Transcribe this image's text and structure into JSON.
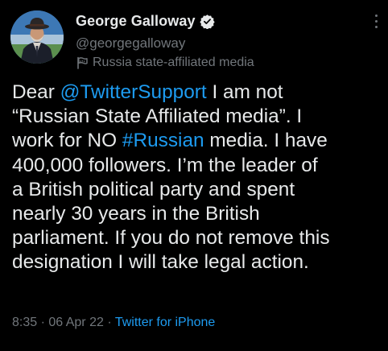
{
  "user": {
    "display_name": "George Galloway",
    "handle": "@georgegalloway",
    "label": "Russia state-affiliated media"
  },
  "tweet": {
    "lines": [
      {
        "pre": "Dear ",
        "link": "@TwitterSupport",
        "post": " I am not"
      },
      {
        "pre": "“Russian State Affiliated media”. I",
        "link": "",
        "post": ""
      },
      {
        "pre": "work for NO ",
        "link": "#Russian",
        "post": " media. I have"
      },
      {
        "pre": "400,000 followers. I’m the leader of",
        "link": "",
        "post": ""
      },
      {
        "pre": "a British political party and spent",
        "link": "",
        "post": ""
      },
      {
        "pre": "nearly 30 years in the British",
        "link": "",
        "post": ""
      },
      {
        "pre": "parliament. If you do not remove this",
        "link": "",
        "post": ""
      },
      {
        "pre": "designation I will take legal action.",
        "link": "",
        "post": ""
      }
    ],
    "time": "8:35",
    "sep1": "·",
    "date": "06 Apr 22",
    "sep2": "·",
    "source": "Twitter for iPhone"
  },
  "icons": {
    "verified": "verified-badge-icon",
    "label": "state-media-flag-icon",
    "more": "more-options-icon"
  },
  "colors": {
    "background": "#000000",
    "text": "#e7e9ea",
    "secondary": "#71767b",
    "link": "#1d9bf0"
  }
}
